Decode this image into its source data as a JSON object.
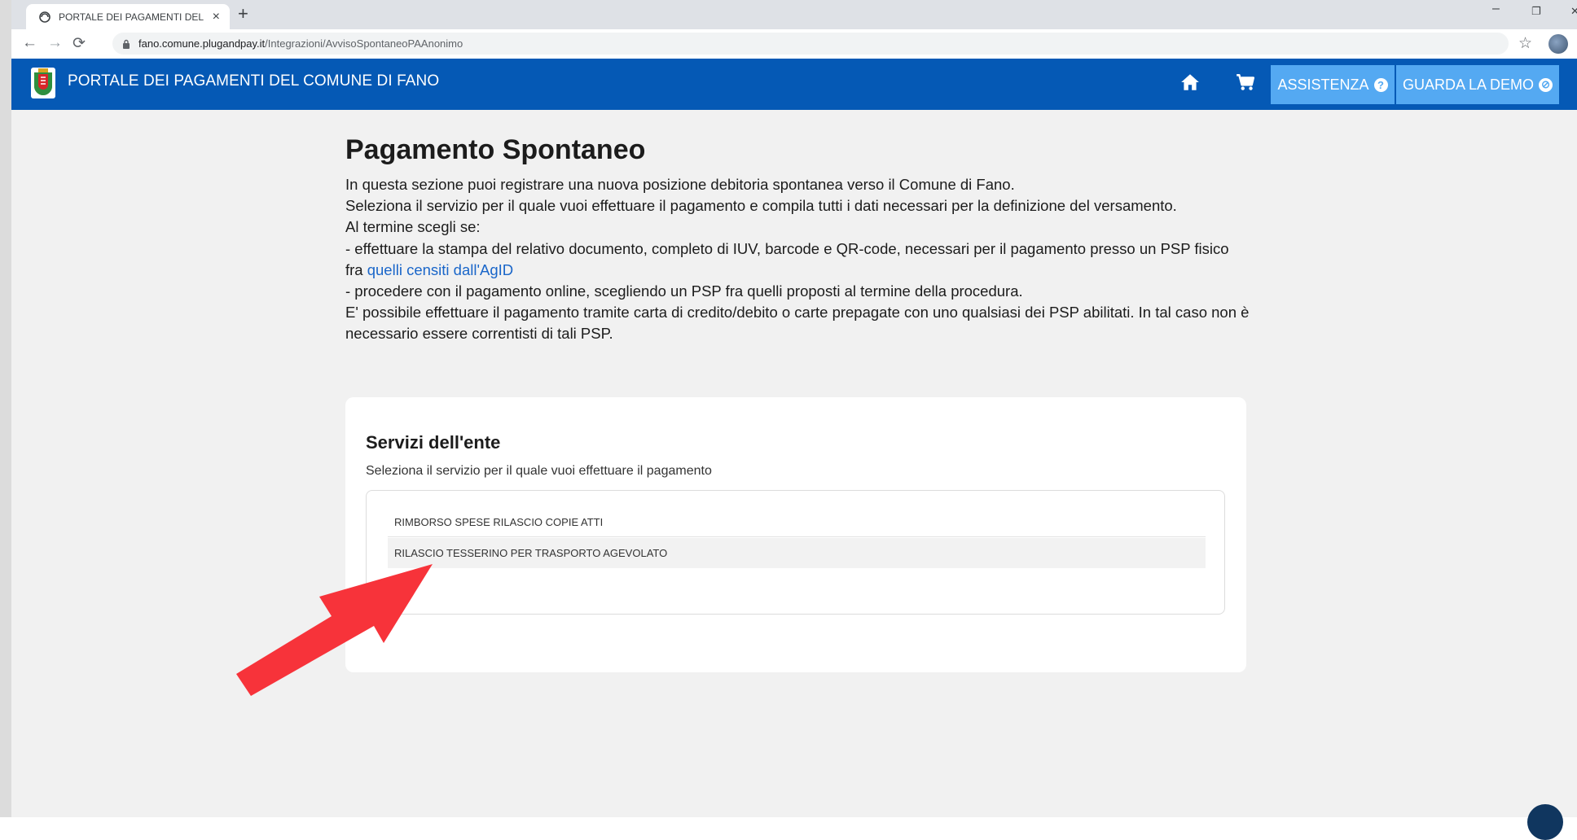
{
  "browser": {
    "tab_title": "PORTALE DEI PAGAMENTI DEL CO",
    "tab_close": "×",
    "new_tab": "+",
    "url_host": "fano.comune.plugandpay.it",
    "url_path": "/Integrazioni/AvvisoSpontaneoPAAnonimo",
    "back": "←",
    "forward": "→",
    "reload": "⟳",
    "star": "☆",
    "menu": "⋮",
    "win_min": "–",
    "win_max": "❐",
    "win_close": "✕"
  },
  "header": {
    "title": "PORTALE DEI PAGAMENTI DEL COMUNE DI FANO",
    "home_icon": "home-icon",
    "cart_icon": "cart-icon",
    "help_button": "ASSISTENZA",
    "help_glyph": "?",
    "demo_button": "GUARDA LA DEMO",
    "demo_glyph": "⊘",
    "color": "#0559b5",
    "button_color": "#54a9f2"
  },
  "page": {
    "title": "Pagamento Spontaneo",
    "line1": "In questa sezione puoi registrare una nuova posizione debitoria spontanea verso il Comune di Fano.",
    "line2": "Seleziona il servizio per il quale vuoi effettuare il pagamento e compila tutti i dati necessari per la definizione del versamento.",
    "line3": "Al termine scegli se:",
    "line4": "- effettuare la stampa del relativo documento, completo di IUV, barcode e QR-code, necessari per il pagamento presso un PSP fisico fra",
    "link": "quelli censiti dall'AgID",
    "line5": "- procedere con il pagamento online, scegliendo un PSP fra quelli proposti al termine della procedura.",
    "line6": "E' possibile effettuare il pagamento tramite carta di credito/debito o carte prepagate con uno qualsiasi dei PSP abilitati. In tal caso non è necessario essere correntisti di tali PSP."
  },
  "services": {
    "title": "Servizi dell'ente",
    "subtitle": "Seleziona il servizio per il quale vuoi effettuare il pagamento",
    "items": [
      "RIMBORSO SPESE RILASCIO COPIE ATTI",
      "RILASCIO TESSERINO PER TRASPORTO AGEVOLATO"
    ]
  },
  "annotation": {
    "arrow_color": "#f7333a"
  }
}
